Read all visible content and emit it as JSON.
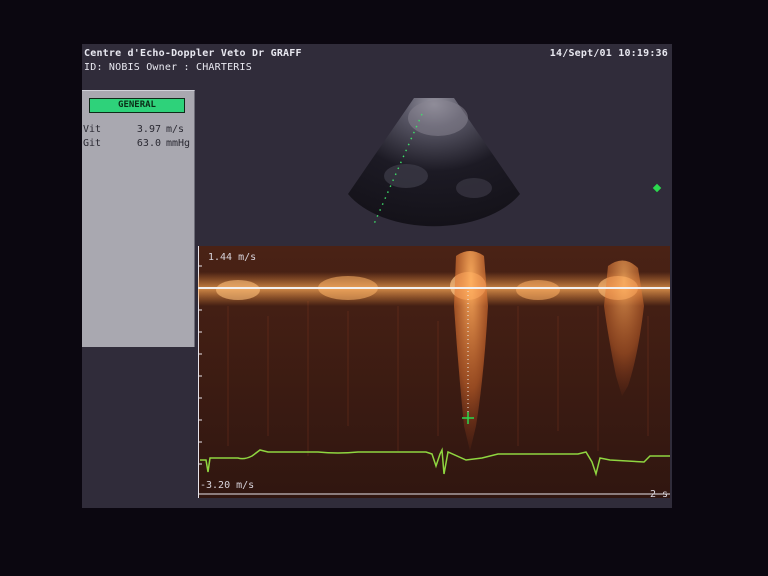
{
  "header": {
    "clinic": "Centre d'Echo-Doppler Veto Dr GRAFF",
    "patient_line": "ID: NOBIS Owner : CHARTERIS",
    "datetime": "14/Sept/01 10:19:36"
  },
  "side_panel": {
    "mode_label": "GENERAL",
    "measurements": [
      {
        "label": "Vit",
        "value": "3.97",
        "unit": "m/s"
      },
      {
        "label": "Git",
        "value": "63.0",
        "unit": "mmHg"
      }
    ]
  },
  "doppler": {
    "top_velocity": "1.44 m/s",
    "bottom_velocity": "-3.20 m/s",
    "time_scale": "2 s"
  },
  "colors": {
    "spectral": "#ff9a40",
    "baseline": "#f3f0f0",
    "ecg": "#8fd640",
    "marker": "#2bd94e",
    "mode_tab": "#2ed27a"
  }
}
